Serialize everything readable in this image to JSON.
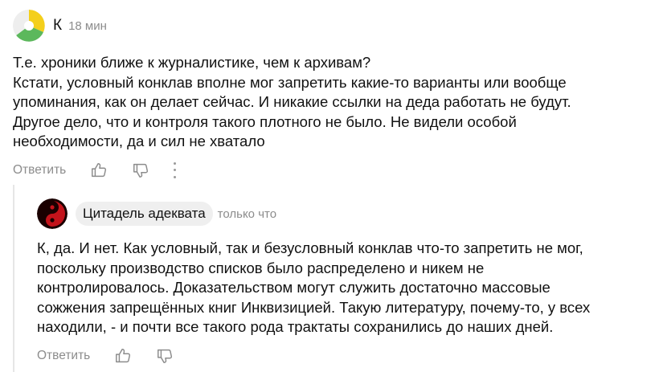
{
  "comments": [
    {
      "author": "К",
      "time": "18 мин",
      "lines": [
        "Т.е. хроники ближе к журналистике, чем к архивам?",
        "Кстати, условный конклав вполне мог запретить какие-то варианты или вообще",
        "упоминания, как он делает сейчас. И никакие ссылки на деда работать не будут.",
        "Другое дело, что и контроля такого плотного не было. Не видели особой",
        "необходимости, да и сил не хватало"
      ],
      "reply_label": "Ответить",
      "icons": [
        "thumbs-up-icon",
        "thumbs-down-icon",
        "more-vertical-icon"
      ]
    },
    {
      "author": "Цитадель адеквата",
      "time": "только что",
      "lines": [
        "К, да. И нет. Как условный, так и безусловный конклав что-то запретить не мог,",
        "поскольку производство списков было распределено и никем не",
        "контролировалось. Доказательством могут служить достаточно массовые",
        "сожжения запрещённых книг Инквизицией. Такую литературу, почему-то, у всех",
        "находили, - и почти все такого рода трактаты сохранились до наших дней."
      ],
      "reply_label": "Ответить",
      "icons": [
        "thumbs-up-icon",
        "thumbs-down-icon"
      ]
    }
  ],
  "colors": {
    "text": "#111111",
    "muted": "#8c8c8c",
    "chip_bg": "#efefef",
    "thread_line": "#e6e6e6"
  }
}
